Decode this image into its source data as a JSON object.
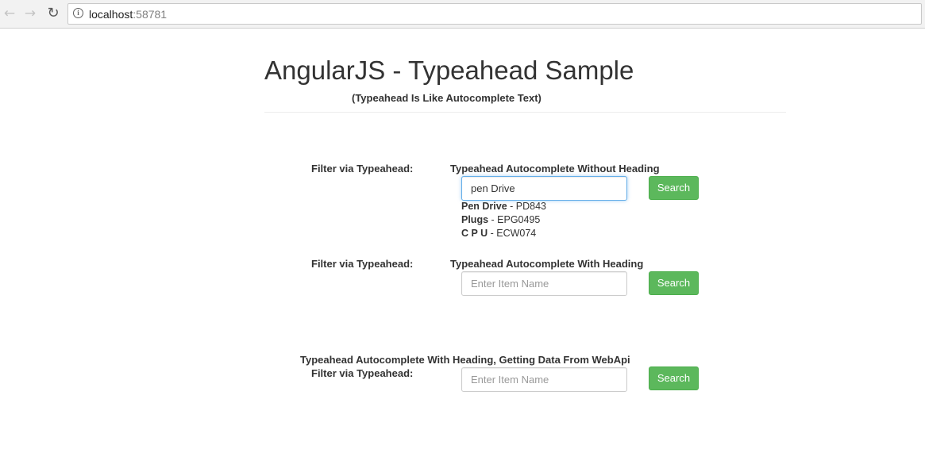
{
  "browser": {
    "url_host": "localhost",
    "url_port": ":58781"
  },
  "header": {
    "title": "AngularJS - Typeahead Sample",
    "subtitle": "(Typeahead Is Like Autocomplete Text)"
  },
  "section1": {
    "filter_label": "Filter via Typeahead:",
    "heading": "Typeahead Autocomplete Without Heading",
    "input_value": "pen Drive",
    "button_label": "Search",
    "suggestions": [
      {
        "name": "Pen Drive",
        "sep": " - ",
        "code": "PD843"
      },
      {
        "name": "Plugs",
        "sep": " - ",
        "code": "EPG0495"
      },
      {
        "name": "C P U",
        "sep": " - ",
        "code": "ECW074"
      }
    ]
  },
  "section2": {
    "filter_label": "Filter via Typeahead:",
    "heading": "Typeahead Autocomplete With Heading",
    "input_placeholder": "Enter Item Name",
    "button_label": "Search"
  },
  "section3": {
    "heading": "Typeahead Autocomplete With Heading, Getting Data From WebApi",
    "filter_label": "Filter via Typeahead:",
    "input_placeholder": "Enter Item Name",
    "button_label": "Search"
  }
}
